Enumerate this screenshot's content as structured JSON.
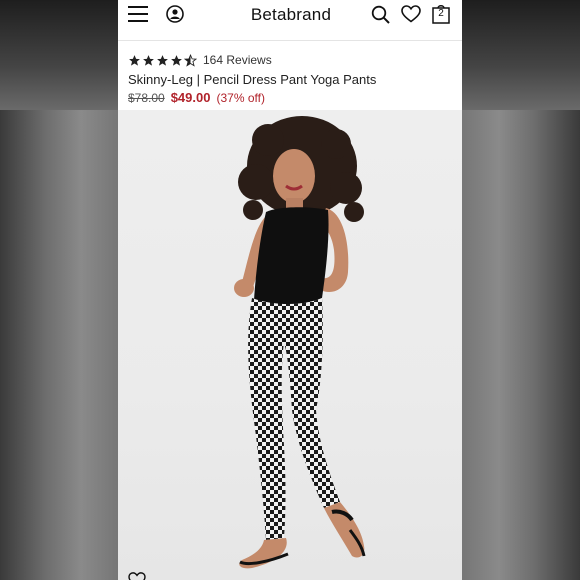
{
  "header": {
    "brand": "Betabrand",
    "cart_count": "2",
    "icons": [
      "menu-icon",
      "account-icon",
      "search-icon",
      "heart-icon",
      "bag-icon"
    ]
  },
  "product": {
    "rating": 4.5,
    "reviews": "164 Reviews",
    "title": "Skinny-Leg | Pencil Dress Pant Yoga Pants",
    "original_price": "$78.00",
    "sale_price": "$49.00",
    "discount": "(37% off)"
  },
  "colors": {
    "sale": "#b1232b",
    "star": "#222222"
  }
}
